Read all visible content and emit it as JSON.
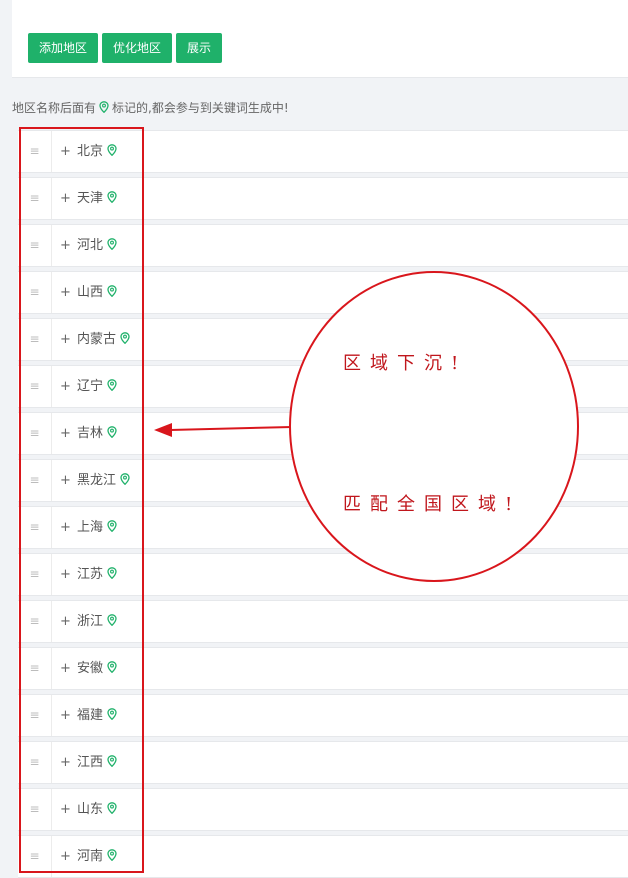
{
  "toolbar": {
    "add_label": "添加地区",
    "optimize_label": "优化地区",
    "show_label": "展示"
  },
  "hint": {
    "before": "地区名称后面有",
    "after": "标记的,都会参与到关键词生成中!"
  },
  "icons": {
    "handle": "drag-handle-icon",
    "expand": "plus-icon",
    "pin": "location-pin-icon"
  },
  "colors": {
    "accent": "#1fb16a",
    "annotation": "#d9161c"
  },
  "regions": [
    {
      "name": "北京",
      "plus": "+"
    },
    {
      "name": "天津",
      "plus": "+"
    },
    {
      "name": "河北",
      "plus": "+"
    },
    {
      "name": "山西",
      "plus": "+"
    },
    {
      "name": "内蒙古",
      "plus": "+"
    },
    {
      "name": "辽宁",
      "plus": "+"
    },
    {
      "name": "吉林",
      "plus": "+"
    },
    {
      "name": "黑龙江",
      "plus": "+"
    },
    {
      "name": "上海",
      "plus": "+"
    },
    {
      "name": "江苏",
      "plus": "+"
    },
    {
      "name": "浙江",
      "plus": "+"
    },
    {
      "name": "安徽",
      "plus": "+"
    },
    {
      "name": "福建",
      "plus": "+"
    },
    {
      "name": "江西",
      "plus": "+"
    },
    {
      "name": "山东",
      "plus": "+"
    },
    {
      "name": "河南",
      "plus": "+"
    }
  ],
  "annotation": {
    "line1": "区域下沉!",
    "line2": "匹配全国区域!"
  }
}
